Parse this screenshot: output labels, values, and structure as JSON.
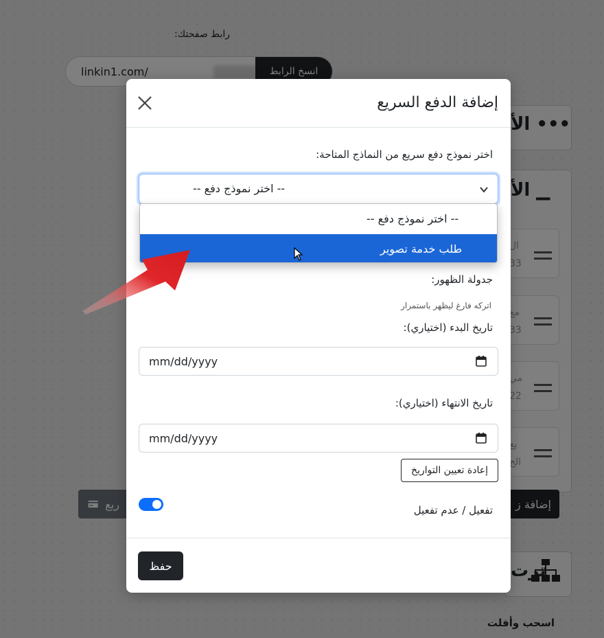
{
  "background": {
    "page_link_label": "رابط صفحتك:",
    "url_prefix": "linkin1.com/",
    "copy_button": "انسخ الرابط",
    "card1_title": "••• الأ",
    "card2_title": "▁ الأ",
    "add_button_partial": "إضافة ز",
    "grey_button_partial": "ريع",
    "items": [
      {
        "a": "ال",
        "b": "33"
      },
      {
        "a": "مع",
        "b": "33"
      },
      {
        "a": "مي",
        "b": "22"
      },
      {
        "a": "يع",
        "b": "الح"
      }
    ],
    "sort_card_title": "ترت",
    "drag_drop_label": "اسحب وأفلت"
  },
  "modal": {
    "title": "إضافة الدفع السريع",
    "select_label": "اختر نموذج دفع سريع من النماذج المتاحة:",
    "select_value": "-- اختر نموذج دفع --",
    "options": [
      "-- اختر نموذج دفع --",
      "طلب خدمة تصوير"
    ],
    "selected_option_index": 1,
    "schedule_label": "جدولة الظهور:",
    "schedule_hint": "اتركه فارغ ليظهر باستمرار",
    "start_date_label": "تاريخ البدء (اختياري):",
    "start_date_placeholder": "mm/dd/yyyy",
    "end_date_label": "تاريخ الانتهاء (اختياري):",
    "end_date_placeholder": "mm/dd/yyyy",
    "reset_dates_button": "إعادة تعيين التواريخ",
    "toggle_label": "تفعيل / عدم تفعيل",
    "toggle_on": true,
    "save_button": "حفظ"
  },
  "colors": {
    "primary": "#0d6efd",
    "selected_option": "#1a66d6",
    "dark_button": "#212529",
    "arrow": "#e0262a"
  }
}
